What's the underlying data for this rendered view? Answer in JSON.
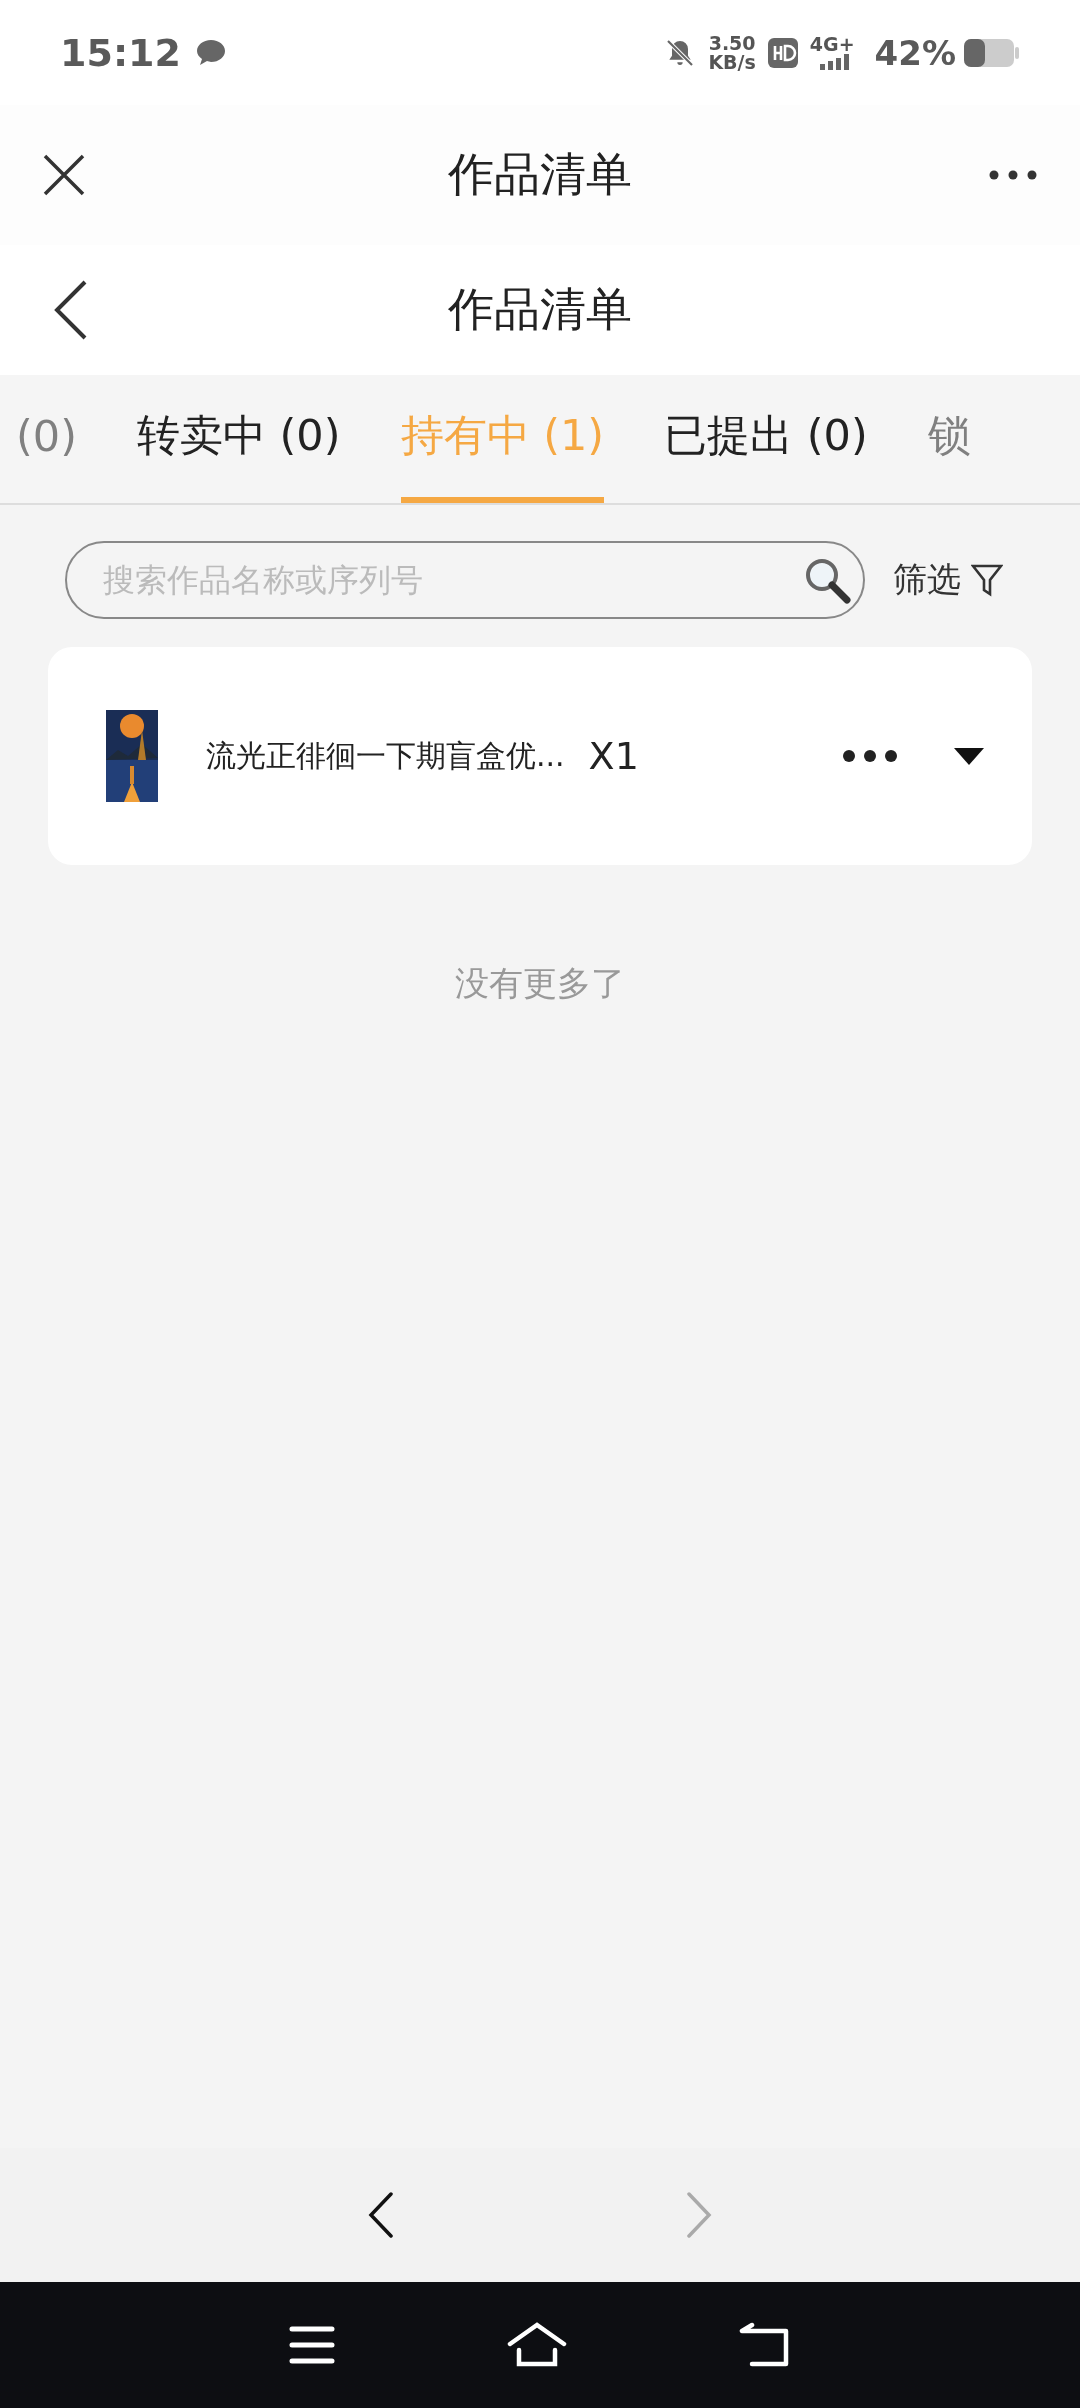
{
  "status_bar": {
    "time": "15:12",
    "speed_value": "3.50",
    "speed_unit": "KB/s",
    "network": "4G+",
    "battery": "42%"
  },
  "top_bar": {
    "title": "作品清单"
  },
  "header": {
    "title": "作品清单"
  },
  "tabs": [
    {
      "label": "(0)",
      "selected": false
    },
    {
      "label": "转卖中 (0)",
      "selected": false
    },
    {
      "label": "持有中 (1)",
      "selected": true
    },
    {
      "label": "已提出 (0)",
      "selected": false
    },
    {
      "label": "锁",
      "selected": false
    }
  ],
  "search": {
    "placeholder": "搜索作品名称或序列号"
  },
  "filter": {
    "label": "筛选"
  },
  "items": [
    {
      "kind": "picture",
      "name": "流光正徘徊一下期盲盒优...",
      "quantity": "X1"
    }
  ],
  "end_note": "没有更多了",
  "browser_nav": {
    "back_disabled": false,
    "forward_disabled": true
  }
}
